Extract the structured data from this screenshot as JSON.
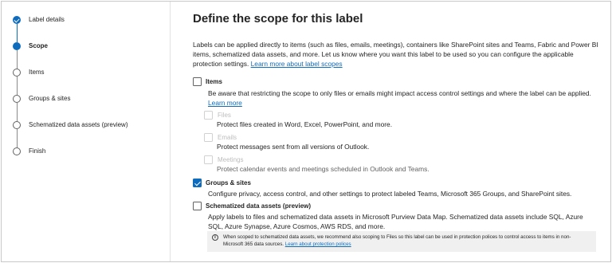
{
  "wizard": {
    "steps": [
      {
        "label": "Label details",
        "state": "done"
      },
      {
        "label": "Scope",
        "state": "current"
      },
      {
        "label": "Items",
        "state": "pending"
      },
      {
        "label": "Groups & sites",
        "state": "pending"
      },
      {
        "label": "Schematized data assets (preview)",
        "state": "pending"
      },
      {
        "label": "Finish",
        "state": "pending"
      }
    ]
  },
  "main": {
    "title": "Define the scope for this label",
    "description": "Labels can be applied directly to items (such as files, emails, meetings), containers like SharePoint sites and Teams, Fabric and Power BI items, schematized data assets, and more. Let us know where you want this label to be used so you can configure the applicable protection settings.",
    "description_link": "Learn more about label scopes",
    "options": {
      "items": {
        "label": "Items",
        "checked": false,
        "description": "Be aware that restricting the scope to only files or emails might impact access control settings and where the label can be applied.",
        "link": "Learn more",
        "sub_options": [
          {
            "label": "Files",
            "description": "Protect files created in Word, Excel, PowerPoint, and more."
          },
          {
            "label": "Emails",
            "description": "Protect messages sent from all versions of Outlook."
          },
          {
            "label": "Meetings",
            "description": "Protect calendar events and meetings scheduled in Outlook and Teams."
          }
        ]
      },
      "groups_sites": {
        "label": "Groups & sites",
        "checked": true,
        "description": "Configure privacy, access control, and other settings to protect labeled Teams, Microsoft 365 Groups, and SharePoint sites."
      },
      "schematized": {
        "label": "Schematized data assets (preview)",
        "checked": false,
        "description": "Apply labels to files and schematized data assets in Microsoft Purview Data Map. Schematized data assets include SQL, Azure SQL, Azure Synapse, Azure Cosmos, AWS RDS, and more.",
        "info_icon": "info-icon",
        "info": "When scoped to schematized data assets, we recommend also scoping to Files so this label can be used in protection polices to control access to items in non-Microsoft 365 data sources.",
        "info_link": "Learn about protection polices"
      }
    }
  },
  "colors": {
    "accent": "#0f6cbd",
    "info_background": "#f0f0f0",
    "disabled_text": "#bdbdbd"
  }
}
